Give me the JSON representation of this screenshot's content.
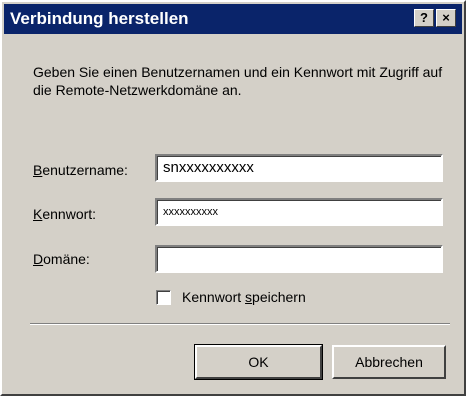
{
  "window": {
    "title": "Verbindung herstellen",
    "help_button": "?",
    "close_button": "×"
  },
  "description": "Geben Sie einen Benutzernamen und ein Kennwort mit Zugriff auf die Remote-Netzwerkdomäne an.",
  "fields": {
    "username": {
      "label_accel": "B",
      "label_rest": "enutzername:",
      "value": "snxxxxxxxxxx"
    },
    "password": {
      "label_accel": "K",
      "label_rest": "ennwort:",
      "value": "xxxxxxxxxx"
    },
    "domain": {
      "label_accel": "D",
      "label_rest": "omäne:",
      "value": ""
    }
  },
  "save_password": {
    "checked": false,
    "label_pre": "Kennwort ",
    "label_accel": "s",
    "label_rest": "peichern"
  },
  "buttons": {
    "ok": "OK",
    "cancel": "Abbrechen"
  },
  "colors": {
    "titlebar": "#0a246a",
    "face": "#d4d0c8"
  }
}
